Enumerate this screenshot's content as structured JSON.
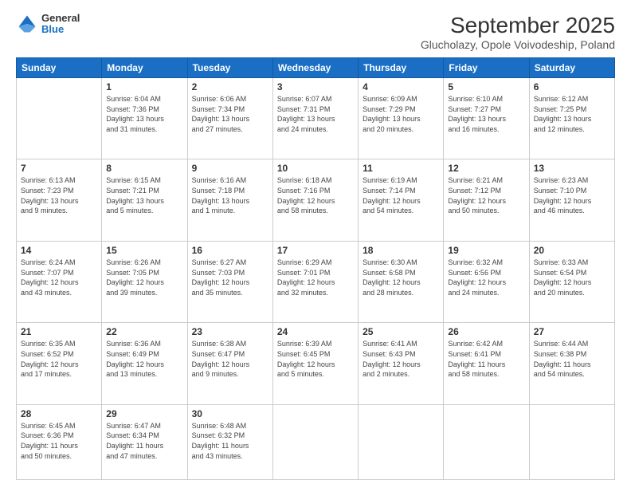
{
  "logo": {
    "general": "General",
    "blue": "Blue"
  },
  "header": {
    "title": "September 2025",
    "subtitle": "Glucholazy, Opole Voivodeship, Poland"
  },
  "weekdays": [
    "Sunday",
    "Monday",
    "Tuesday",
    "Wednesday",
    "Thursday",
    "Friday",
    "Saturday"
  ],
  "weeks": [
    [
      {
        "day": "",
        "info": ""
      },
      {
        "day": "1",
        "info": "Sunrise: 6:04 AM\nSunset: 7:36 PM\nDaylight: 13 hours\nand 31 minutes."
      },
      {
        "day": "2",
        "info": "Sunrise: 6:06 AM\nSunset: 7:34 PM\nDaylight: 13 hours\nand 27 minutes."
      },
      {
        "day": "3",
        "info": "Sunrise: 6:07 AM\nSunset: 7:31 PM\nDaylight: 13 hours\nand 24 minutes."
      },
      {
        "day": "4",
        "info": "Sunrise: 6:09 AM\nSunset: 7:29 PM\nDaylight: 13 hours\nand 20 minutes."
      },
      {
        "day": "5",
        "info": "Sunrise: 6:10 AM\nSunset: 7:27 PM\nDaylight: 13 hours\nand 16 minutes."
      },
      {
        "day": "6",
        "info": "Sunrise: 6:12 AM\nSunset: 7:25 PM\nDaylight: 13 hours\nand 12 minutes."
      }
    ],
    [
      {
        "day": "7",
        "info": "Sunrise: 6:13 AM\nSunset: 7:23 PM\nDaylight: 13 hours\nand 9 minutes."
      },
      {
        "day": "8",
        "info": "Sunrise: 6:15 AM\nSunset: 7:21 PM\nDaylight: 13 hours\nand 5 minutes."
      },
      {
        "day": "9",
        "info": "Sunrise: 6:16 AM\nSunset: 7:18 PM\nDaylight: 13 hours\nand 1 minute."
      },
      {
        "day": "10",
        "info": "Sunrise: 6:18 AM\nSunset: 7:16 PM\nDaylight: 12 hours\nand 58 minutes."
      },
      {
        "day": "11",
        "info": "Sunrise: 6:19 AM\nSunset: 7:14 PM\nDaylight: 12 hours\nand 54 minutes."
      },
      {
        "day": "12",
        "info": "Sunrise: 6:21 AM\nSunset: 7:12 PM\nDaylight: 12 hours\nand 50 minutes."
      },
      {
        "day": "13",
        "info": "Sunrise: 6:23 AM\nSunset: 7:10 PM\nDaylight: 12 hours\nand 46 minutes."
      }
    ],
    [
      {
        "day": "14",
        "info": "Sunrise: 6:24 AM\nSunset: 7:07 PM\nDaylight: 12 hours\nand 43 minutes."
      },
      {
        "day": "15",
        "info": "Sunrise: 6:26 AM\nSunset: 7:05 PM\nDaylight: 12 hours\nand 39 minutes."
      },
      {
        "day": "16",
        "info": "Sunrise: 6:27 AM\nSunset: 7:03 PM\nDaylight: 12 hours\nand 35 minutes."
      },
      {
        "day": "17",
        "info": "Sunrise: 6:29 AM\nSunset: 7:01 PM\nDaylight: 12 hours\nand 32 minutes."
      },
      {
        "day": "18",
        "info": "Sunrise: 6:30 AM\nSunset: 6:58 PM\nDaylight: 12 hours\nand 28 minutes."
      },
      {
        "day": "19",
        "info": "Sunrise: 6:32 AM\nSunset: 6:56 PM\nDaylight: 12 hours\nand 24 minutes."
      },
      {
        "day": "20",
        "info": "Sunrise: 6:33 AM\nSunset: 6:54 PM\nDaylight: 12 hours\nand 20 minutes."
      }
    ],
    [
      {
        "day": "21",
        "info": "Sunrise: 6:35 AM\nSunset: 6:52 PM\nDaylight: 12 hours\nand 17 minutes."
      },
      {
        "day": "22",
        "info": "Sunrise: 6:36 AM\nSunset: 6:49 PM\nDaylight: 12 hours\nand 13 minutes."
      },
      {
        "day": "23",
        "info": "Sunrise: 6:38 AM\nSunset: 6:47 PM\nDaylight: 12 hours\nand 9 minutes."
      },
      {
        "day": "24",
        "info": "Sunrise: 6:39 AM\nSunset: 6:45 PM\nDaylight: 12 hours\nand 5 minutes."
      },
      {
        "day": "25",
        "info": "Sunrise: 6:41 AM\nSunset: 6:43 PM\nDaylight: 12 hours\nand 2 minutes."
      },
      {
        "day": "26",
        "info": "Sunrise: 6:42 AM\nSunset: 6:41 PM\nDaylight: 11 hours\nand 58 minutes."
      },
      {
        "day": "27",
        "info": "Sunrise: 6:44 AM\nSunset: 6:38 PM\nDaylight: 11 hours\nand 54 minutes."
      }
    ],
    [
      {
        "day": "28",
        "info": "Sunrise: 6:45 AM\nSunset: 6:36 PM\nDaylight: 11 hours\nand 50 minutes."
      },
      {
        "day": "29",
        "info": "Sunrise: 6:47 AM\nSunset: 6:34 PM\nDaylight: 11 hours\nand 47 minutes."
      },
      {
        "day": "30",
        "info": "Sunrise: 6:48 AM\nSunset: 6:32 PM\nDaylight: 11 hours\nand 43 minutes."
      },
      {
        "day": "",
        "info": ""
      },
      {
        "day": "",
        "info": ""
      },
      {
        "day": "",
        "info": ""
      },
      {
        "day": "",
        "info": ""
      }
    ]
  ]
}
